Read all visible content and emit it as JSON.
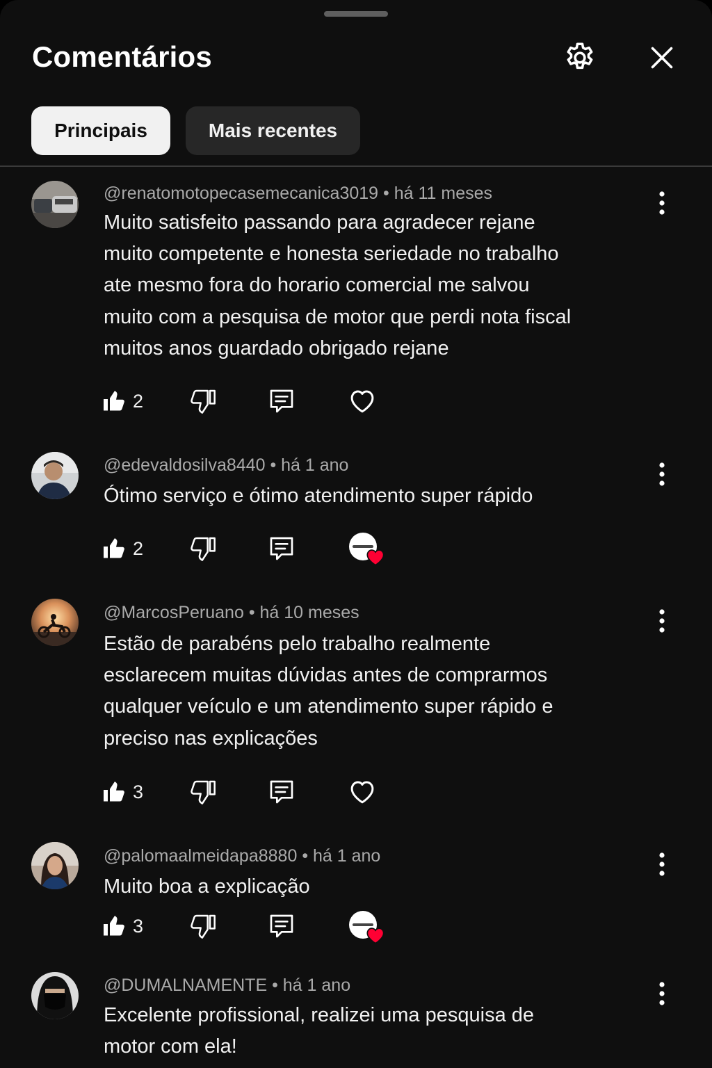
{
  "header": {
    "title": "Comentários",
    "settings_icon": "gear-icon",
    "close_icon": "close-icon"
  },
  "tabs": [
    {
      "label": "Principais",
      "selected": true
    },
    {
      "label": "Mais recentes",
      "selected": false
    }
  ],
  "colors": {
    "background": "#0f0f0f",
    "chip_active_bg": "#f1f1f1",
    "chip_inactive_bg": "#272727",
    "meta_text": "#aaaaaa",
    "heart_red": "#ff0033"
  },
  "comments": [
    {
      "author": "@renatomotopecasemecanica3019",
      "time": "há 11 meses",
      "text": "Muito satisfeito passando para agradecer rejane muito competente e honesta seriedade no trabalho ate mesmo fora do horario comercial me salvou muito com a pesquisa de motor que perdi nota fiscal muitos anos guardado obrigado rejane",
      "likes": "2",
      "creator_hearted": false
    },
    {
      "author": "@edevaldosilva8440",
      "time": "há 1 ano",
      "text": "Ótimo serviço e ótimo atendimento super rápido",
      "likes": "2",
      "creator_hearted": true
    },
    {
      "author": "@MarcosPeruano",
      "time": "há 10 meses",
      "text": "Estão de parabéns pelo trabalho realmente esclarecem muitas dúvidas antes de comprarmos qualquer veículo e um atendimento super rápido e preciso nas explicações",
      "likes": "3",
      "creator_hearted": false
    },
    {
      "author": "@palomaalmeidapa8880",
      "time": "há 1 ano",
      "text": "Muito boa a explicação",
      "likes": "3",
      "creator_hearted": true
    },
    {
      "author": "@DUMALNAMENTE",
      "time": "há 1 ano",
      "text": "Excelente profissional, realizei uma pesquisa de motor com ela!"
    }
  ]
}
